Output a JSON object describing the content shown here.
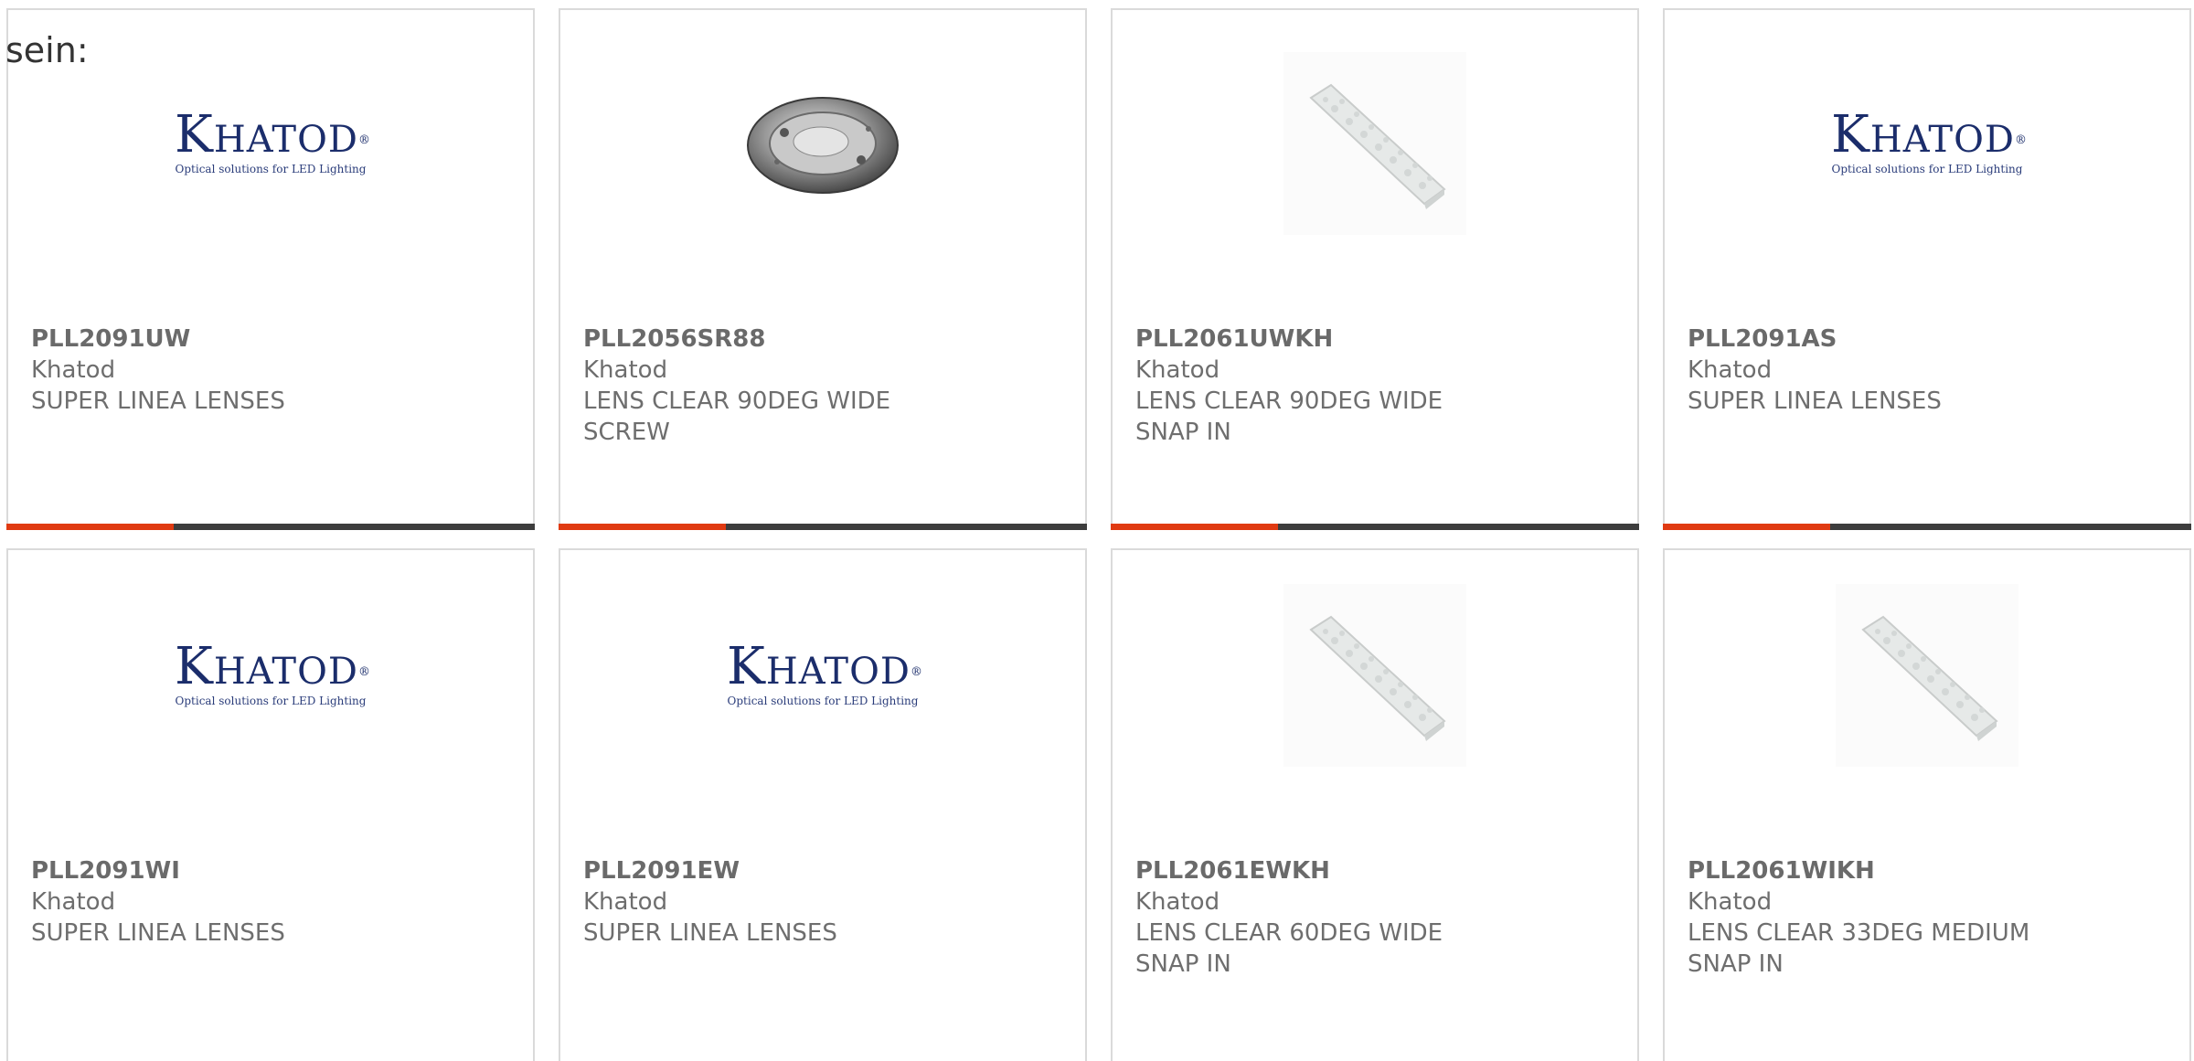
{
  "intro_text": "sein:",
  "logo": {
    "initial": "K",
    "rest": "HATOD",
    "reg": "®",
    "tagline": "Optical solutions for LED Lighting"
  },
  "colors": {
    "accent": "#e03a12",
    "bar": "#3d3d3d",
    "border": "#dadada",
    "text": "#6e6e6e",
    "logo": "#1b2d6b"
  },
  "products": [
    {
      "part_number": "PLL2091UW",
      "manufacturer": "Khatod",
      "description": "SUPER LINEA LENSES",
      "image": "khatod-logo"
    },
    {
      "part_number": "PLL2056SR88",
      "manufacturer": "Khatod",
      "description": "LENS CLEAR 90DEG WIDE SCREW",
      "image": "round-lens-photo"
    },
    {
      "part_number": "PLL2061UWKH",
      "manufacturer": "Khatod",
      "description": "LENS CLEAR 90DEG WIDE SNAP IN",
      "image": "strip-lens-photo"
    },
    {
      "part_number": "PLL2091AS",
      "manufacturer": "Khatod",
      "description": "SUPER LINEA LENSES",
      "image": "khatod-logo"
    },
    {
      "part_number": "PLL2091WI",
      "manufacturer": "Khatod",
      "description": "SUPER LINEA LENSES",
      "image": "khatod-logo"
    },
    {
      "part_number": "PLL2091EW",
      "manufacturer": "Khatod",
      "description": "SUPER LINEA LENSES",
      "image": "khatod-logo"
    },
    {
      "part_number": "PLL2061EWKH",
      "manufacturer": "Khatod",
      "description": "LENS CLEAR 60DEG WIDE SNAP IN",
      "image": "strip-lens-photo"
    },
    {
      "part_number": "PLL2061WIKH",
      "manufacturer": "Khatod",
      "description": "LENS CLEAR 33DEG MEDIUM SNAP IN",
      "image": "strip-lens-photo"
    }
  ]
}
